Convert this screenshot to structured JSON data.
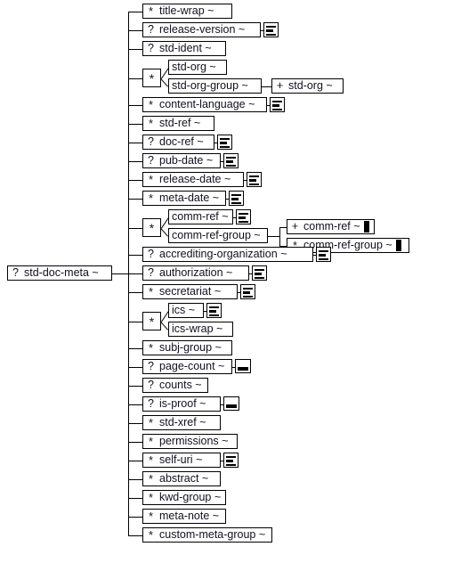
{
  "diagram": {
    "type": "xml-content-model-tree",
    "title": "std-doc-meta",
    "occurrence_legend": {
      "optional": "?",
      "zero_or_more": "*",
      "one_or_more": "+"
    },
    "icons": {
      "mixed_content": "lines-icon",
      "empty_element": "box-icon",
      "recursive": "black-bar-icon",
      "operator_repeat": "asterisk-operator-icon"
    },
    "root": {
      "occurrence": "?",
      "label": "std-doc-meta ~"
    },
    "children": [
      {
        "occurrence": "*",
        "label": "title-wrap ~"
      },
      {
        "occurrence": "?",
        "label": "release-version ~",
        "icon": "lines"
      },
      {
        "occurrence": "?",
        "label": "std-ident ~"
      },
      {
        "operator": "*",
        "branches": [
          {
            "label": "std-org ~"
          },
          {
            "label": "std-org-group ~",
            "children": [
              {
                "occurrence": "+",
                "label": "std-org ~"
              }
            ]
          }
        ]
      },
      {
        "occurrence": "*",
        "label": "content-language ~",
        "icon": "lines"
      },
      {
        "occurrence": "*",
        "label": "std-ref ~"
      },
      {
        "occurrence": "?",
        "label": "doc-ref ~",
        "icon": "lines"
      },
      {
        "occurrence": "?",
        "label": "pub-date ~",
        "icon": "lines"
      },
      {
        "occurrence": "*",
        "label": "release-date ~",
        "icon": "lines"
      },
      {
        "occurrence": "*",
        "label": "meta-date ~",
        "icon": "lines"
      },
      {
        "operator": "*",
        "branches": [
          {
            "label": "comm-ref ~",
            "icon": "lines"
          },
          {
            "label": "comm-ref-group ~",
            "children": [
              {
                "occurrence": "+",
                "label": "comm-ref ~",
                "icon": "bar"
              },
              {
                "occurrence": "*",
                "label": "comm-ref-group ~",
                "icon": "bar"
              }
            ]
          }
        ]
      },
      {
        "occurrence": "?",
        "label": "accrediting-organization ~",
        "icon": "lines"
      },
      {
        "occurrence": "?",
        "label": "authorization ~",
        "icon": "lines"
      },
      {
        "occurrence": "*",
        "label": "secretariat ~",
        "icon": "lines"
      },
      {
        "operator": "*",
        "branches": [
          {
            "label": "ics ~",
            "icon": "lines"
          },
          {
            "label": "ics-wrap ~"
          }
        ]
      },
      {
        "occurrence": "*",
        "label": "subj-group ~"
      },
      {
        "occurrence": "?",
        "label": "page-count ~",
        "icon": "box"
      },
      {
        "occurrence": "?",
        "label": "counts ~"
      },
      {
        "occurrence": "?",
        "label": "is-proof ~",
        "icon": "box"
      },
      {
        "occurrence": "*",
        "label": "std-xref ~"
      },
      {
        "occurrence": "*",
        "label": "permissions ~"
      },
      {
        "occurrence": "*",
        "label": "self-uri ~",
        "icon": "lines"
      },
      {
        "occurrence": "*",
        "label": "abstract ~"
      },
      {
        "occurrence": "*",
        "label": "kwd-group ~"
      },
      {
        "occurrence": "*",
        "label": "meta-note ~"
      },
      {
        "occurrence": "*",
        "label": "custom-meta-group ~"
      }
    ]
  }
}
